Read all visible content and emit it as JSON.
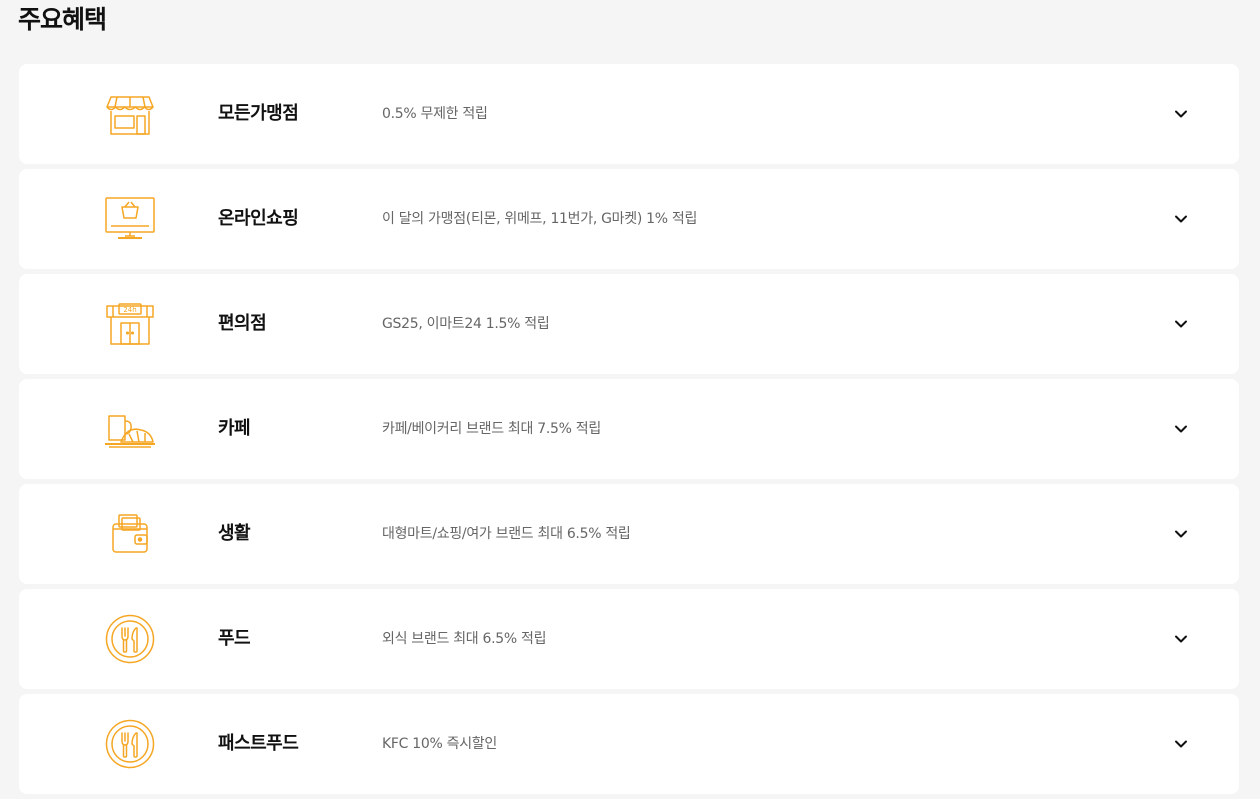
{
  "page": {
    "title": "주요혜택"
  },
  "accent_color": "#f5a623",
  "benefits": [
    {
      "icon": "storefront-icon",
      "name": "모든가맹점",
      "desc": "0.5% 무제한 적립"
    },
    {
      "icon": "monitor-cart-icon",
      "name": "온라인쇼핑",
      "desc": "이 달의 가맹점(티몬, 위메프, 11번가, G마켓) 1% 적립"
    },
    {
      "icon": "convenience-store-icon",
      "name": "편의점",
      "desc": "GS25, 이마트24 1.5% 적립"
    },
    {
      "icon": "coffee-croissant-icon",
      "name": "카페",
      "desc": "카페/베이커리 브랜드 최대 7.5% 적립"
    },
    {
      "icon": "wallet-icon",
      "name": "생활",
      "desc": "대형마트/쇼핑/여가 브랜드 최대 6.5% 적립"
    },
    {
      "icon": "plate-cutlery-icon",
      "name": "푸드",
      "desc": "외식 브랜드 최대 6.5% 적립"
    },
    {
      "icon": "plate-cutlery-icon",
      "name": "패스트푸드",
      "desc": "KFC 10% 즉시할인"
    }
  ]
}
